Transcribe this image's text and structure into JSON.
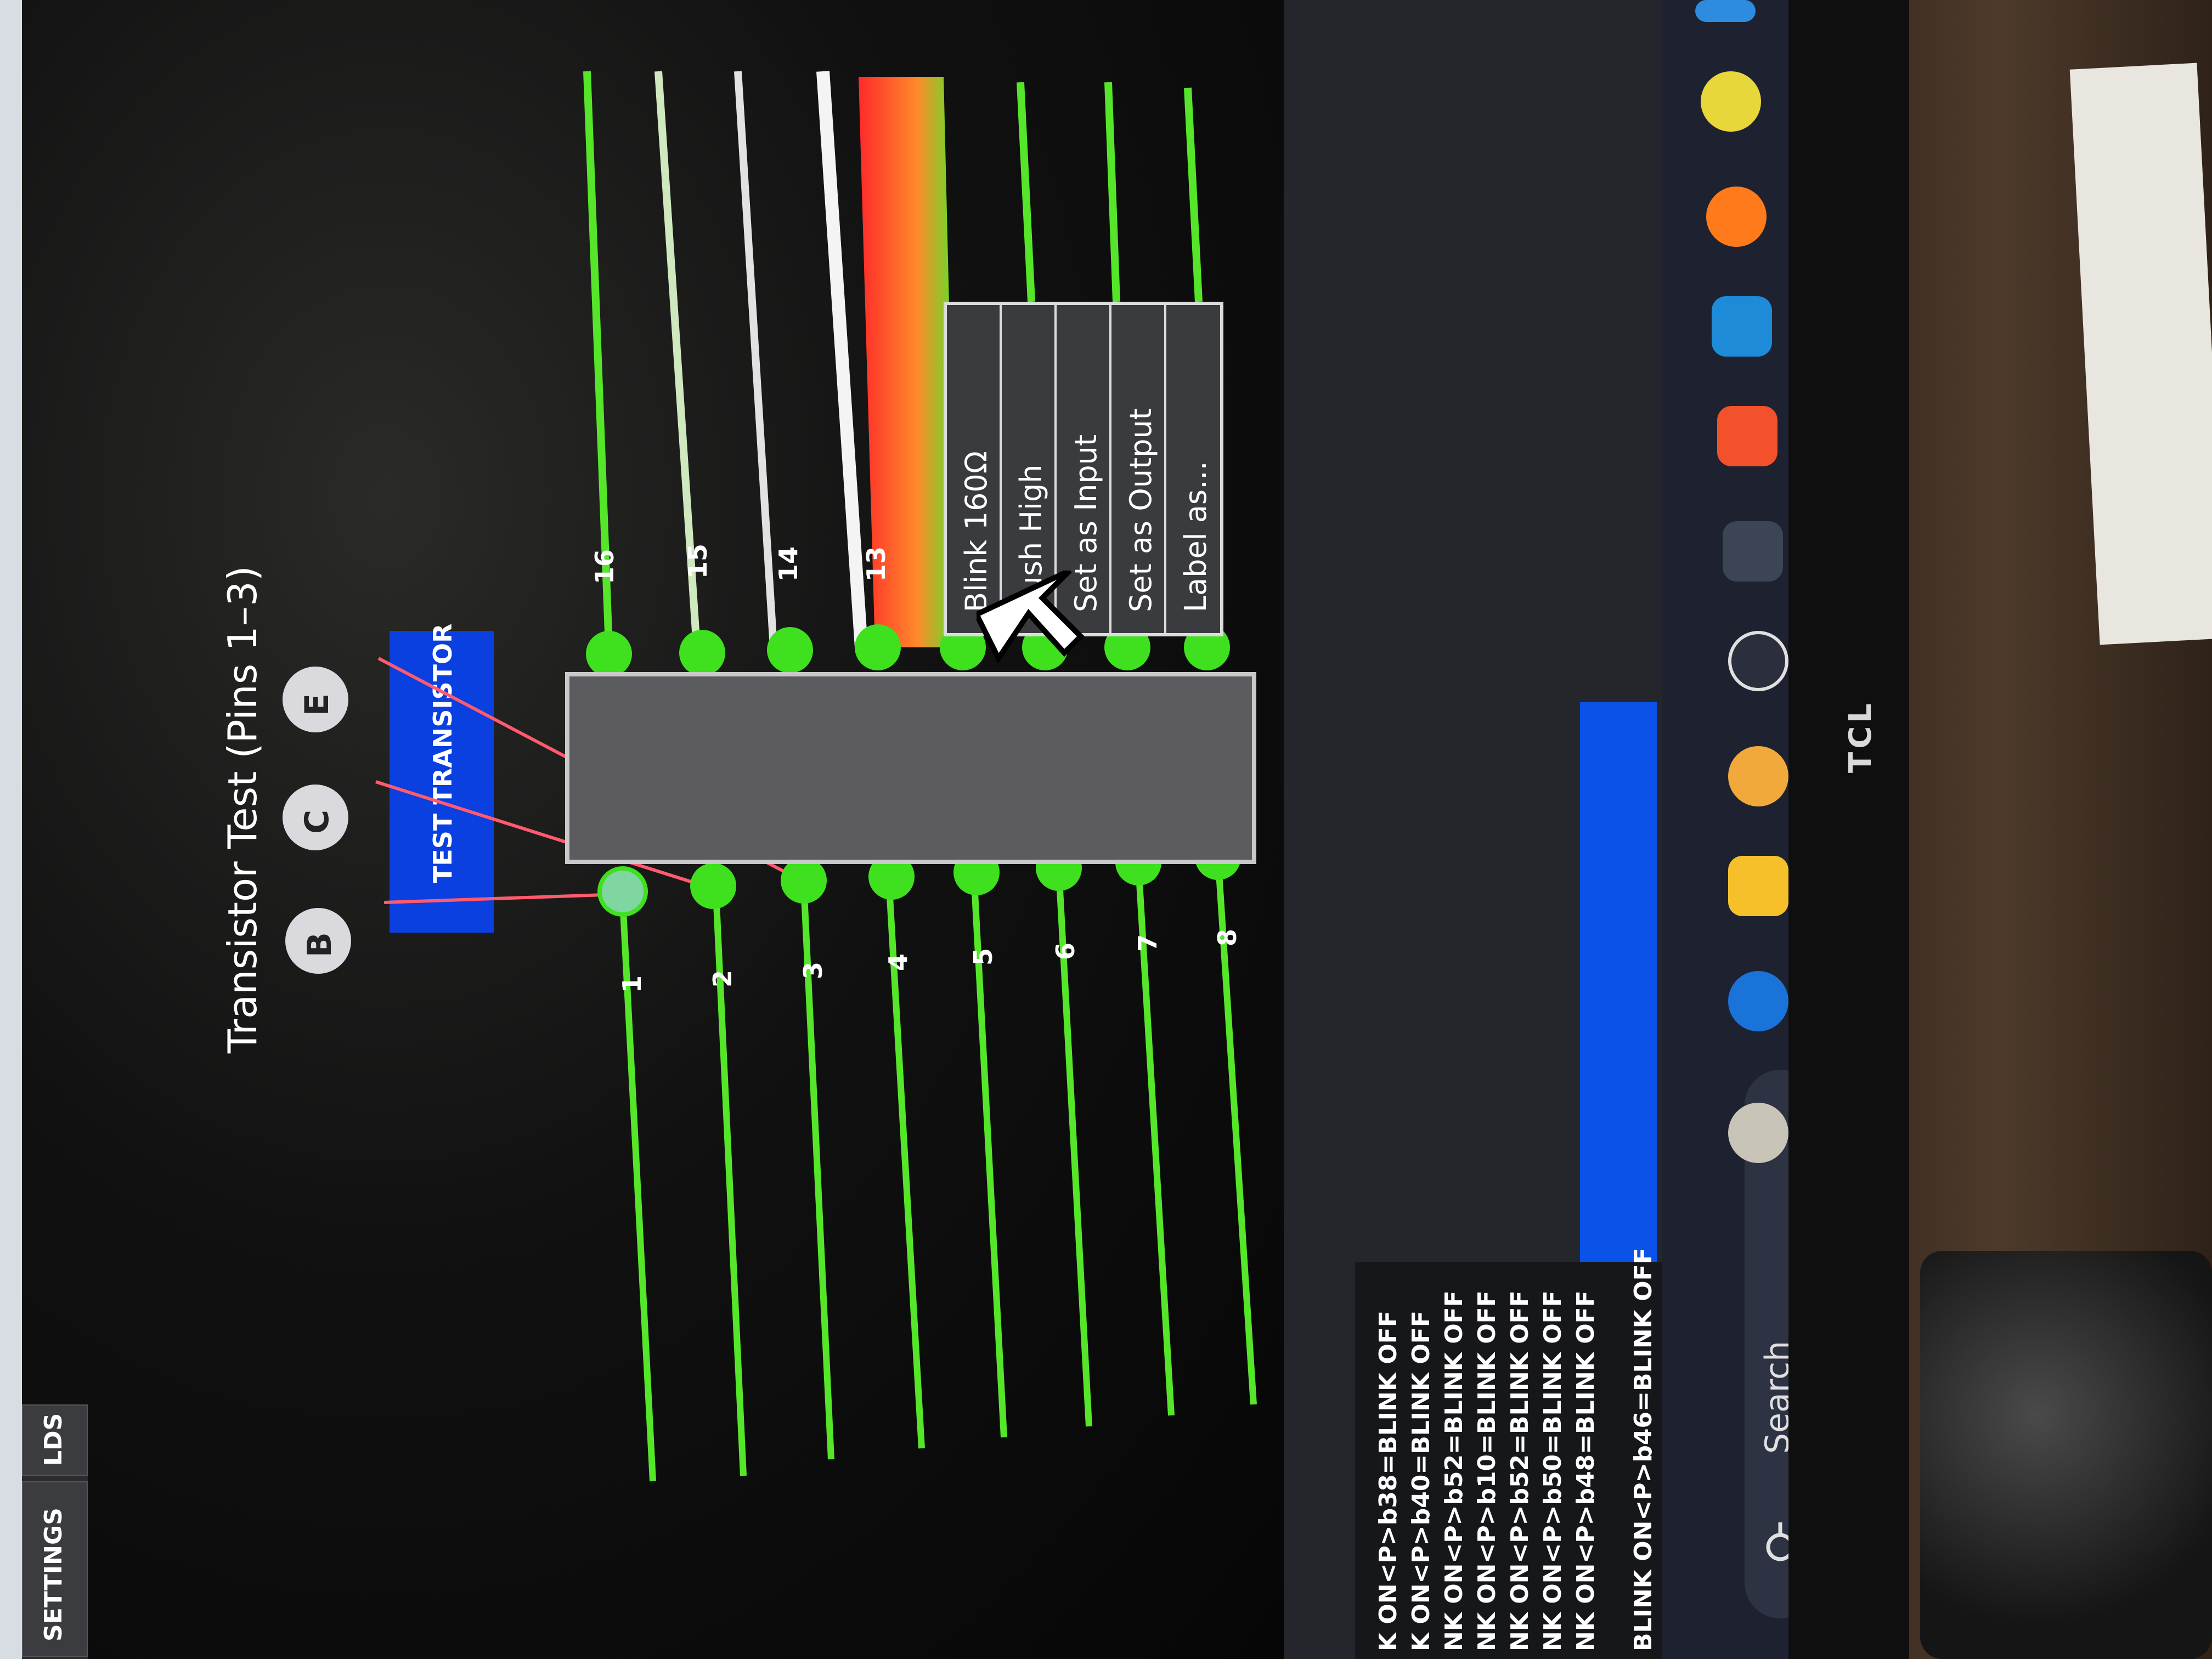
{
  "sidebar": {
    "tabs": [
      {
        "label": "SETTINGS"
      },
      {
        "label": "LDS"
      }
    ]
  },
  "main": {
    "title": "Transistor Test (Pins 1–3)",
    "pin_buttons": [
      {
        "label": "B"
      },
      {
        "label": "C"
      },
      {
        "label": "E"
      }
    ],
    "test_button_label": "TEST TRANSISTOR",
    "top_pins": [
      "16",
      "15",
      "14",
      "13"
    ],
    "bottom_pins": [
      "1",
      "2",
      "3",
      "4",
      "5",
      "6",
      "7",
      "8"
    ]
  },
  "context_menu": {
    "items": [
      {
        "label": "Blink 160Ω"
      },
      {
        "label": "Push High"
      },
      {
        "label": "Set as Input"
      },
      {
        "label": "Set as Output"
      },
      {
        "label": "Label as..."
      }
    ]
  },
  "log": {
    "lines": [
      "K ON<P>b38=BLINK OFF",
      "K ON<P>b40=BLINK OFF",
      "NK ON<P>b52=BLINK OFF",
      "NK ON<P>b10=BLINK OFF",
      "NK ON<P>b52=BLINK OFF",
      "NK ON<P>b50=BLINK OFF",
      "NK ON<P>b48=BLINK OFF",
      "BLINK ON<P>b46=BLINK OFF"
    ]
  },
  "taskbar": {
    "search_label": "Search",
    "icons": [
      "pebbles-icon",
      "outlook-icon",
      "file-explorer-icon",
      "weather-icon",
      "chatgpt-icon",
      "terminal-icon",
      "brave-icon",
      "vscode-icon",
      "firefox-icon",
      "app-icon",
      "app-icon-2"
    ]
  },
  "monitor": {
    "brand": "TCL"
  },
  "colors": {
    "accent_blue": "#0a3fe0",
    "trace_green": "#55e62a",
    "pin_green": "#3fe01e",
    "wire_red": "#ff5a6e"
  }
}
